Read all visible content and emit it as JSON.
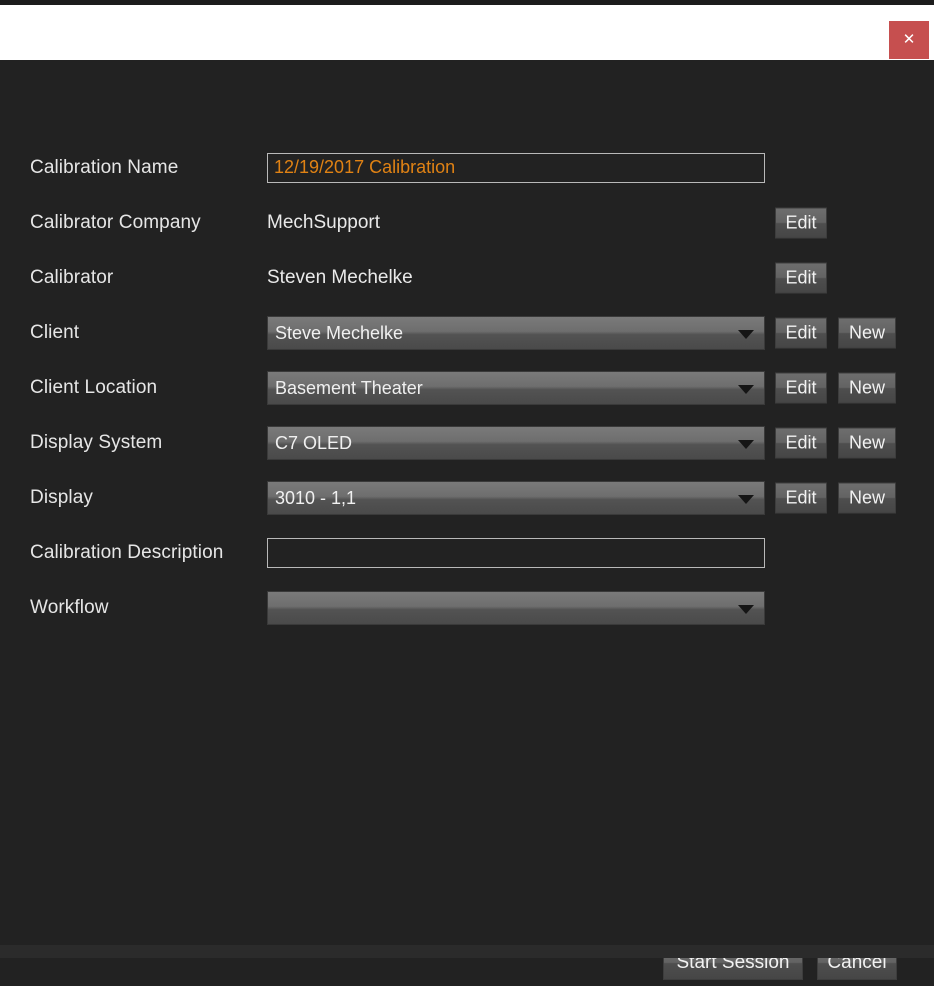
{
  "window": {
    "close_label": "✕"
  },
  "form": {
    "rows": [
      {
        "label": "Calibration Name",
        "type": "input",
        "value": "12/19/2017 Calibration",
        "placeholder": "",
        "accent": "#e08214",
        "has_edit": false,
        "has_new": false
      },
      {
        "label": "Calibrator Company",
        "type": "static",
        "value": "MechSupport",
        "has_edit": true,
        "has_new": false
      },
      {
        "label": "Calibrator",
        "type": "static",
        "value": "Steven Mechelke",
        "has_edit": true,
        "has_new": false
      },
      {
        "label": "Client",
        "type": "dropdown",
        "value": "Steve Mechelke",
        "has_edit": true,
        "has_new": true
      },
      {
        "label": "Client Location",
        "type": "dropdown",
        "value": "Basement Theater",
        "has_edit": true,
        "has_new": true
      },
      {
        "label": "Display System",
        "type": "dropdown",
        "value": "C7 OLED",
        "has_edit": true,
        "has_new": true
      },
      {
        "label": "Display",
        "type": "dropdown",
        "value": "3010  - 1,1",
        "has_edit": true,
        "has_new": true
      },
      {
        "label": "Calibration Description",
        "type": "input",
        "value": "",
        "placeholder": "",
        "has_edit": false,
        "has_new": false
      },
      {
        "label": "Workflow",
        "type": "dropdown",
        "value": "",
        "has_edit": false,
        "has_new": false
      }
    ],
    "edit_label": "Edit",
    "new_label": "New"
  },
  "footer": {
    "start_label": "Start Session",
    "cancel_label": "Cancel"
  },
  "colors": {
    "background": "#222222",
    "titlebar": "#ffffff",
    "close_button": "#c64f4f",
    "accent_text": "#e08214",
    "label_text": "#e6e6e6"
  }
}
